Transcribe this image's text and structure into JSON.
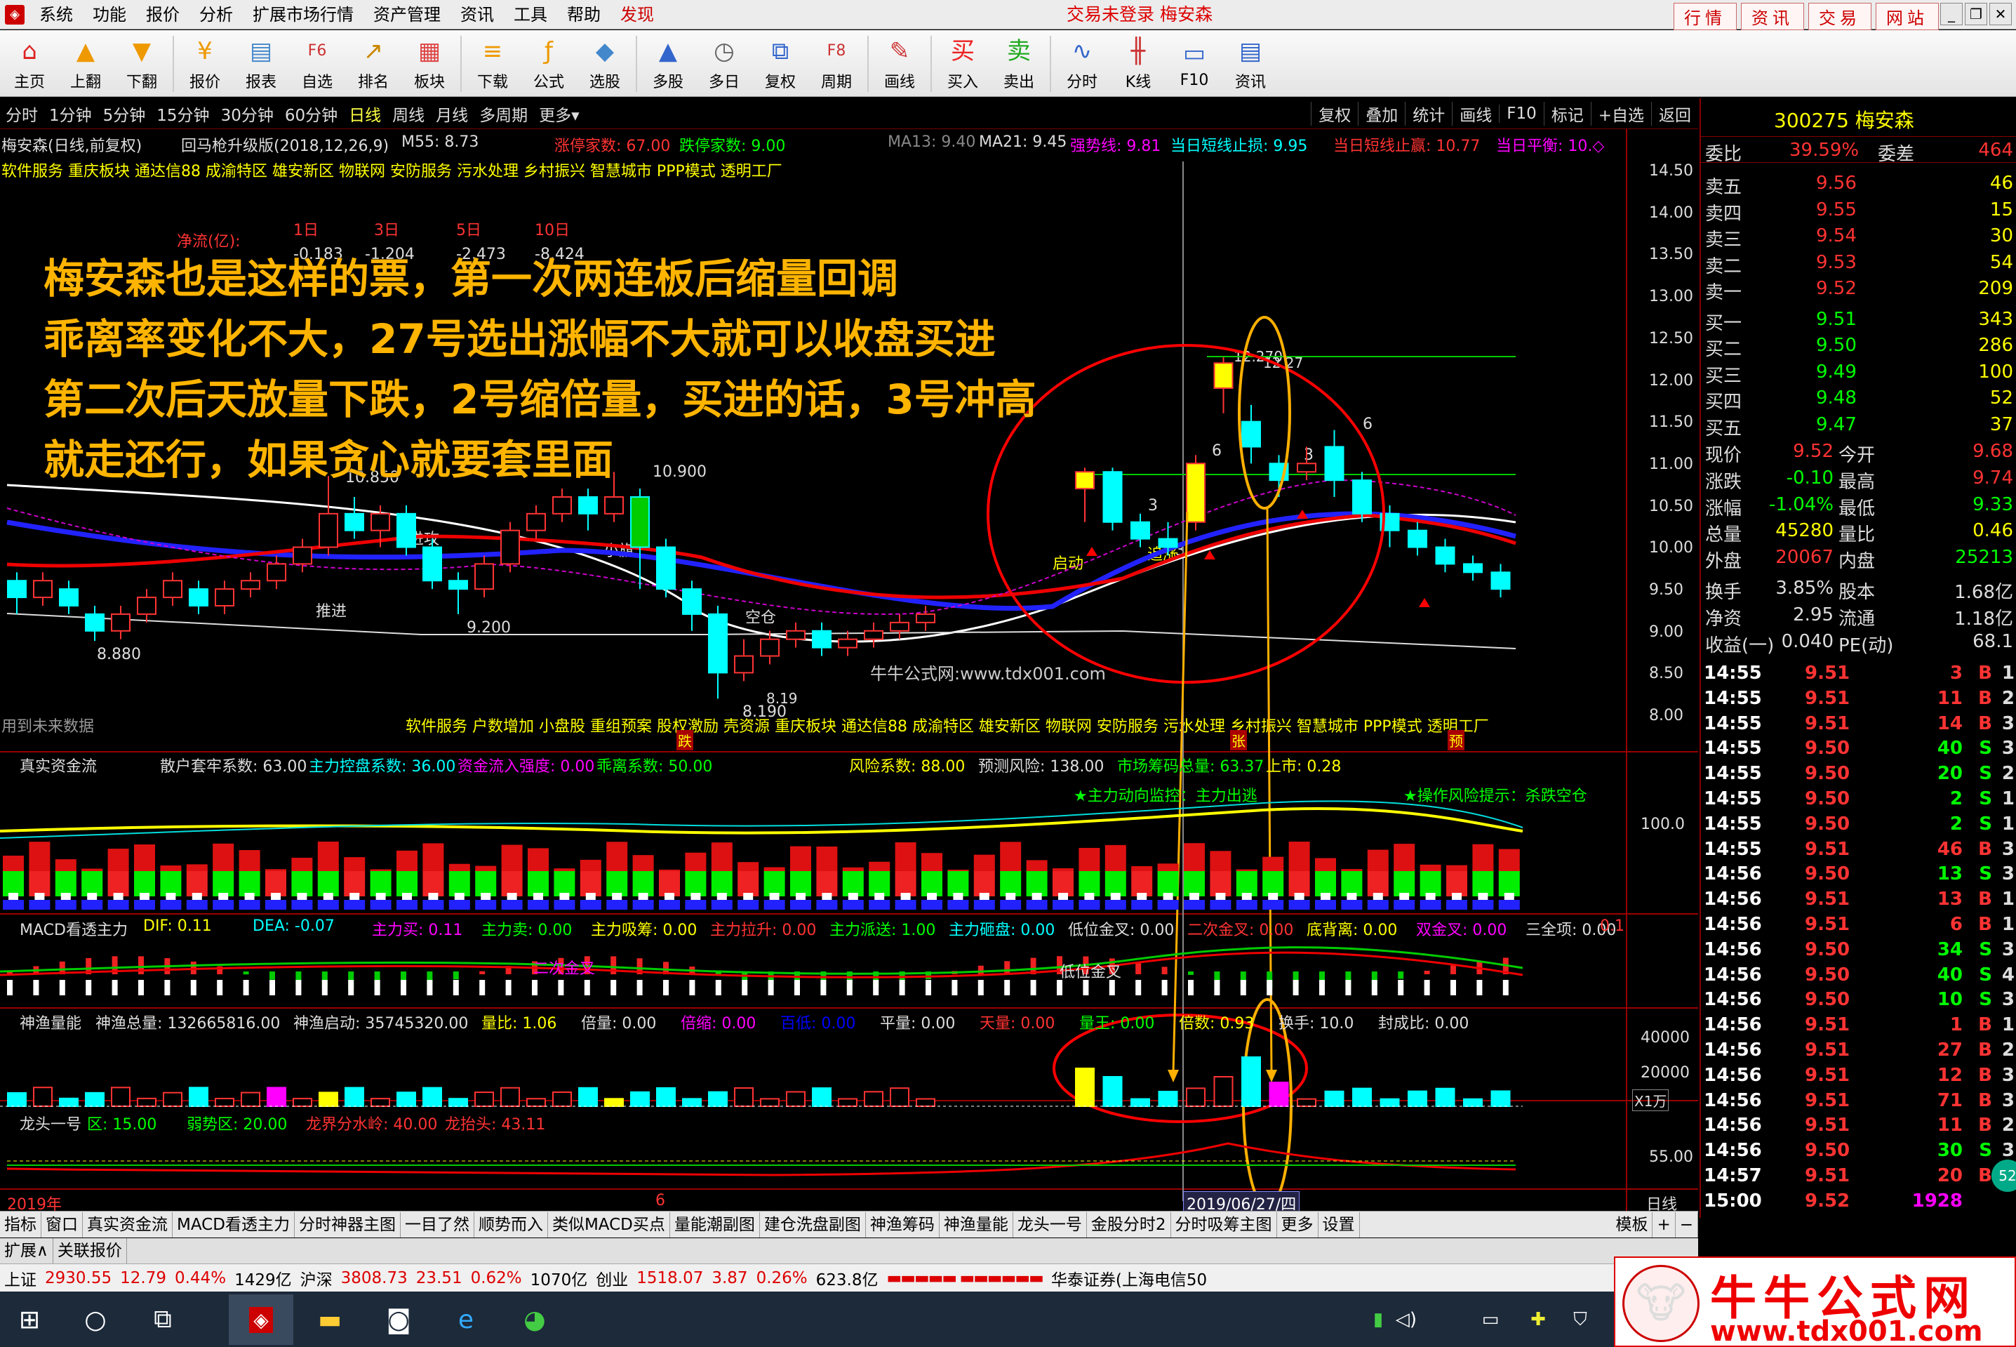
{
  "menubar": {
    "items": [
      "系统",
      "功能",
      "报价",
      "分析",
      "扩展市场行情",
      "资产管理",
      "资讯",
      "工具",
      "帮助"
    ],
    "active": "发现",
    "center": "交易未登录  梅安森",
    "right_tabs": [
      "行情",
      "资讯",
      "交易",
      "网站"
    ]
  },
  "toolbar": [
    {
      "label": "主页",
      "icon": "home-icon",
      "glyph": "⌂",
      "color": "#d22"
    },
    {
      "label": "上翻",
      "icon": "arrow-up-icon",
      "glyph": "▲",
      "color": "#e90"
    },
    {
      "label": "下翻",
      "icon": "arrow-down-icon",
      "glyph": "▼",
      "color": "#e90"
    },
    {
      "label": "报价",
      "icon": "yen-icon",
      "glyph": "¥",
      "color": "#e90"
    },
    {
      "label": "报表",
      "icon": "report-icon",
      "glyph": "▤",
      "color": "#48c"
    },
    {
      "label": "自选",
      "icon": "f6-icon",
      "glyph": "F6",
      "color": "#c33"
    },
    {
      "label": "排名",
      "icon": "rank-icon",
      "glyph": "↗",
      "color": "#c80"
    },
    {
      "label": "板块",
      "icon": "block-icon",
      "glyph": "▦",
      "color": "#d44"
    },
    {
      "label": "下载",
      "icon": "download-icon",
      "glyph": "≡",
      "color": "#e90"
    },
    {
      "label": "公式",
      "icon": "formula-icon",
      "glyph": "ƒ",
      "color": "#e90"
    },
    {
      "label": "选股",
      "icon": "stock-pick-icon",
      "glyph": "◆",
      "color": "#48c"
    },
    {
      "label": "多股",
      "icon": "multi-stock-icon",
      "glyph": "▲",
      "color": "#36c"
    },
    {
      "label": "多日",
      "icon": "clock-icon",
      "glyph": "◷",
      "color": "#666"
    },
    {
      "label": "复权",
      "icon": "restore-icon",
      "glyph": "⧉",
      "color": "#36c"
    },
    {
      "label": "周期",
      "icon": "f8-icon",
      "glyph": "F8",
      "color": "#c33"
    },
    {
      "label": "画线",
      "icon": "pencil-icon",
      "glyph": "✎",
      "color": "#c33"
    },
    {
      "label": "买入",
      "icon": "buy-icon",
      "glyph": "买",
      "color": "#e22"
    },
    {
      "label": "卖出",
      "icon": "sell-icon",
      "glyph": "卖",
      "color": "#2a2"
    },
    {
      "label": "分时",
      "icon": "timeline-icon",
      "glyph": "∿",
      "color": "#36c"
    },
    {
      "label": "K线",
      "icon": "kline-icon",
      "glyph": "╫",
      "color": "#c33"
    },
    {
      "label": "F10",
      "icon": "f10-icon",
      "glyph": "▭",
      "color": "#36c"
    },
    {
      "label": "资讯",
      "icon": "news-icon",
      "glyph": "▤",
      "color": "#36c"
    }
  ],
  "periods": [
    "分时",
    "1分钟",
    "5分钟",
    "15分钟",
    "30分钟",
    "60分钟",
    "日线",
    "周线",
    "月线",
    "多周期",
    "更多▾"
  ],
  "period_active": "日线",
  "period_right": [
    "复权",
    "叠加",
    "统计",
    "画线",
    "F10",
    "标记",
    "+自选",
    "返回"
  ],
  "main": {
    "title": "梅安森(日线,前复权)",
    "formula": "回马枪升级版(2018,12,26,9)",
    "m55": "M55: 8.73",
    "zt": "涨停家数: 67.00",
    "dt": "跌停家数: 9.00",
    "ma13": "MA13: 9.40",
    "ma21": "MA21: 9.45",
    "qsx": "强势线: 9.81",
    "stop_loss": "当日短线止损: 9.95",
    "stop_profit": "当日短线止赢: 10.77",
    "balance": "当日平衡: 10.◇",
    "concepts": "软件服务 重庆板块 通达信88 成渝特区 雄安新区 物联网 安防服务 污水处理 乡村振兴 智慧城市 PPP模式 透明工厂",
    "concepts_bottom": "软件服务 户数增加 小盘股 重组预案 股权激励 壳资源 重庆板块 通达信88 成渝特区 雄安新区 物联网 安防服务 污水处理 乡村振兴 智慧城市 PPP模式 透明工厂",
    "flow_title": "净流(亿):",
    "flow_heads": [
      "1日",
      "3日",
      "5日",
      "10日"
    ],
    "flow_vals": [
      "-0.183",
      "-1.204",
      "-2.473",
      "-8.424"
    ],
    "future_data": "用到未来数据",
    "watermark": "牛牛公式网:www.tdx001.com",
    "labels": {
      "tuijin": "推进",
      "jinggong": "进攻",
      "xiaoqi": "小旗",
      "kongcang": "空仓",
      "qidong": "启动",
      "zhuangqi": "追涨"
    },
    "prices": {
      "p1": "10.850",
      "p2": "10.900",
      "p3": "9.200",
      "p4": "8.880",
      "p5": "8.190",
      "p6": "8.19",
      "p7": "12.270",
      "p8": "12.27"
    },
    "markers": {
      "die": "跌",
      "zhang": "张",
      "yu": "预"
    },
    "y_ticks": [
      "14.50",
      "14.00",
      "13.50",
      "13.00",
      "12.50",
      "12.00",
      "11.50",
      "11.00",
      "10.50",
      "10.00",
      "9.50",
      "9.00",
      "8.50",
      "8.00"
    ],
    "counts": [
      "3",
      "3",
      "6",
      "3",
      "6"
    ]
  },
  "annotation": [
    "梅安森也是这样的票，第一次两连板后缩量回调",
    "乖离率变化不大，27号选出涨幅不大就可以收盘买进",
    "第二次后天放量下跌，2号缩倍量，买进的话，3号冲高",
    "就走还行，如果贪心就要套里面"
  ],
  "panel1": {
    "title": "真实资金流",
    "items": [
      "散户套牢系数: 63.00",
      "主力控盘系数: 36.00",
      "资金流入强度: 0.00",
      "乖离系数: 50.00",
      "风险系数: 88.00",
      "预测风险: 138.00",
      "市场筹码总量: 63.37",
      "上市: 0.28"
    ],
    "alert1": "★主力动向监控：主力出逃",
    "alert2": "★操作风险提示：杀跌空仓",
    "tick": "100.0"
  },
  "panel2": {
    "title": "MACD看透主力",
    "items": [
      "DIF: 0.11",
      "DEA: -0.07",
      "主力买: 0.11",
      "主力卖: 0.00",
      "主力吸筹: 0.00",
      "主力拉升: 0.00",
      "主力派送: 1.00",
      "主力砸盘: 0.00",
      "低位金叉: 0.00",
      "二次金叉: 0.00",
      "底背离: 0.00",
      "双金叉: 0.00",
      "三全项: 0.00"
    ],
    "right": "0.1",
    "cross1": "二次金叉",
    "cross2": "低位金叉"
  },
  "panel3": {
    "title": "神渔量能",
    "items": [
      "神渔总量: 132665816.00",
      "神渔启动: 35745320.00",
      "量比: 1.06",
      "倍量: 0.00",
      "倍缩: 0.00",
      "百低: 0.00",
      "平量: 0.00",
      "天量: 0.00",
      "量王: 0.00",
      "倍数: 0.93",
      "换手: 10.0",
      "封成比: 0.00"
    ],
    "ticks": [
      "40000",
      "20000",
      "X1万"
    ]
  },
  "panel4": {
    "title": "龙头一号",
    "items": [
      "区: 15.00",
      "弱势区: 20.00",
      "龙界分水岭: 40.00",
      "龙抬头: 43.11"
    ],
    "tick": "55.00"
  },
  "xaxis": {
    "left": "2019年",
    "mid": "6",
    "cursor": "2019/06/27/四",
    "right": "日线"
  },
  "rightpanel": {
    "code": "300275 梅安森",
    "weibi_label": "委比",
    "weibi": "39.59%",
    "weicha_label": "委差",
    "weicha": "464",
    "sells": [
      {
        "label": "卖五",
        "price": "9.56",
        "vol": "46"
      },
      {
        "label": "卖四",
        "price": "9.55",
        "vol": "15"
      },
      {
        "label": "卖三",
        "price": "9.54",
        "vol": "30"
      },
      {
        "label": "卖二",
        "price": "9.53",
        "vol": "54"
      },
      {
        "label": "卖一",
        "price": "9.52",
        "vol": "209"
      }
    ],
    "buys": [
      {
        "label": "买一",
        "price": "9.51",
        "vol": "343"
      },
      {
        "label": "买二",
        "price": "9.50",
        "vol": "286"
      },
      {
        "label": "买三",
        "price": "9.49",
        "vol": "100"
      },
      {
        "label": "买四",
        "price": "9.48",
        "vol": "52"
      },
      {
        "label": "买五",
        "price": "9.47",
        "vol": "37"
      }
    ],
    "stats": [
      {
        "l1": "现价",
        "v1": "9.52",
        "l2": "今开",
        "v2": "9.68",
        "c1": "#f33",
        "c2": "#f33"
      },
      {
        "l1": "涨跌",
        "v1": "-0.10",
        "l2": "最高",
        "v2": "9.74",
        "c1": "#0f0",
        "c2": "#f33"
      },
      {
        "l1": "涨幅",
        "v1": "-1.04%",
        "l2": "最低",
        "v2": "9.33",
        "c1": "#0f0",
        "c2": "#0f0"
      },
      {
        "l1": "总量",
        "v1": "45280",
        "l2": "量比",
        "v2": "0.46",
        "c1": "#ff0",
        "c2": "#ff0"
      },
      {
        "l1": "外盘",
        "v1": "20067",
        "l2": "内盘",
        "v2": "25213",
        "c1": "#f33",
        "c2": "#0f0"
      },
      {
        "l1": "换手",
        "v1": "3.85%",
        "l2": "股本",
        "v2": "1.68亿",
        "c1": "#ddd",
        "c2": "#ddd"
      },
      {
        "l1": "净资",
        "v1": "2.95",
        "l2": "流通",
        "v2": "1.18亿",
        "c1": "#ddd",
        "c2": "#ddd"
      },
      {
        "l1": "收益(一)",
        "v1": "0.040",
        "l2": "PE(动)",
        "v2": "68.1",
        "c1": "#ddd",
        "c2": "#ddd"
      }
    ],
    "ticks": [
      {
        "t": "14:55",
        "p": "9.51",
        "v": "3",
        "s": "B",
        "n": "1"
      },
      {
        "t": "14:55",
        "p": "9.51",
        "v": "11",
        "s": "B",
        "n": "2"
      },
      {
        "t": "14:55",
        "p": "9.51",
        "v": "14",
        "s": "B",
        "n": "3"
      },
      {
        "t": "14:55",
        "p": "9.50",
        "v": "40",
        "s": "S",
        "n": "3"
      },
      {
        "t": "14:55",
        "p": "9.50",
        "v": "20",
        "s": "S",
        "n": "2"
      },
      {
        "t": "14:55",
        "p": "9.50",
        "v": "2",
        "s": "S",
        "n": "1"
      },
      {
        "t": "14:55",
        "p": "9.50",
        "v": "2",
        "s": "S",
        "n": "1"
      },
      {
        "t": "14:55",
        "p": "9.51",
        "v": "46",
        "s": "B",
        "n": "3"
      },
      {
        "t": "14:56",
        "p": "9.50",
        "v": "13",
        "s": "S",
        "n": "3"
      },
      {
        "t": "14:56",
        "p": "9.51",
        "v": "13",
        "s": "B",
        "n": "1"
      },
      {
        "t": "14:56",
        "p": "9.51",
        "v": "6",
        "s": "B",
        "n": "1"
      },
      {
        "t": "14:56",
        "p": "9.50",
        "v": "34",
        "s": "S",
        "n": "3"
      },
      {
        "t": "14:56",
        "p": "9.50",
        "v": "40",
        "s": "S",
        "n": "4"
      },
      {
        "t": "14:56",
        "p": "9.50",
        "v": "10",
        "s": "S",
        "n": "3"
      },
      {
        "t": "14:56",
        "p": "9.51",
        "v": "1",
        "s": "B",
        "n": "1"
      },
      {
        "t": "14:56",
        "p": "9.51",
        "v": "27",
        "s": "B",
        "n": "2"
      },
      {
        "t": "14:56",
        "p": "9.51",
        "v": "12",
        "s": "B",
        "n": "3"
      },
      {
        "t": "14:56",
        "p": "9.51",
        "v": "71",
        "s": "B",
        "n": "3"
      },
      {
        "t": "14:56",
        "p": "9.51",
        "v": "11",
        "s": "B",
        "n": "2"
      },
      {
        "t": "14:56",
        "p": "9.50",
        "v": "30",
        "s": "S",
        "n": "3"
      },
      {
        "t": "14:57",
        "p": "9.51",
        "v": "20",
        "s": "B",
        "n": "3"
      },
      {
        "t": "15:00",
        "p": "9.52",
        "v": "1928",
        "s": "",
        "n": ""
      }
    ],
    "bottom_badge": "52"
  },
  "tabs": [
    "指标",
    "窗口",
    "真实资金流",
    "MACD看透主力",
    "分时神器主图",
    "一目了然",
    "顺势而入",
    "类似MACD买点",
    "量能潮副图",
    "建仓洗盘副图",
    "神渔筹码",
    "神渔量能",
    "龙头一号",
    "金股分时2",
    "分时吸筹主图",
    "更多",
    "设置"
  ],
  "tabs_right": [
    "模板",
    "+",
    "−"
  ],
  "tabs2": [
    "扩展∧",
    "关联报价"
  ],
  "status": {
    "sh_label": "上证",
    "sh": "2930.55",
    "sh_chg": "12.79",
    "sh_pct": "0.44%",
    "sh_amt": "1429亿",
    "hs_label": "沪深",
    "hs": "3808.73",
    "hs_chg": "23.51",
    "hs_pct": "0.62%",
    "hs_amt": "1070亿",
    "cy_label": "创业",
    "cy": "1518.07",
    "cy_chg": "3.87",
    "cy_pct": "0.26%",
    "cy_amt": "623.8亿",
    "broker": "华泰证券(上海电信50"
  },
  "logo": {
    "title": "牛牛公式网",
    "url": "www.tdx001.com"
  },
  "chart_data": {
    "type": "candlestick",
    "title": "梅安森(日线,前复权)",
    "y_ticks": [
      14.5,
      14.0,
      13.5,
      13.0,
      12.5,
      12.0,
      11.5,
      11.0,
      10.5,
      10.0,
      9.5,
      9.0,
      8.5,
      8.0
    ],
    "ylim": [
      7.8,
      14.7
    ],
    "candles": [
      [
        9.4,
        9.6,
        9.2,
        9.7,
        "d"
      ],
      [
        9.6,
        9.4,
        9.3,
        9.7,
        "u"
      ],
      [
        9.5,
        9.3,
        9.2,
        9.6,
        "d"
      ],
      [
        9.2,
        9.0,
        8.88,
        9.3,
        "d"
      ],
      [
        9.0,
        9.2,
        8.9,
        9.3,
        "u"
      ],
      [
        9.2,
        9.4,
        9.1,
        9.5,
        "u"
      ],
      [
        9.4,
        9.6,
        9.3,
        9.7,
        "u"
      ],
      [
        9.5,
        9.3,
        9.2,
        9.6,
        "d"
      ],
      [
        9.3,
        9.5,
        9.2,
        9.6,
        "u"
      ],
      [
        9.5,
        9.6,
        9.4,
        9.7,
        "u"
      ],
      [
        9.6,
        9.8,
        9.5,
        9.9,
        "u"
      ],
      [
        9.8,
        10.0,
        9.7,
        10.1,
        "u"
      ],
      [
        10.0,
        10.4,
        9.9,
        10.85,
        "u"
      ],
      [
        10.4,
        10.2,
        10.1,
        10.6,
        "d"
      ],
      [
        10.2,
        10.4,
        10.0,
        10.5,
        "u"
      ],
      [
        10.4,
        10.0,
        9.9,
        10.5,
        "d"
      ],
      [
        10.0,
        9.6,
        9.5,
        10.1,
        "d"
      ],
      [
        9.6,
        9.5,
        9.2,
        9.7,
        "d"
      ],
      [
        9.5,
        9.8,
        9.4,
        9.9,
        "u"
      ],
      [
        9.8,
        10.2,
        9.7,
        10.3,
        "u"
      ],
      [
        10.2,
        10.4,
        10.1,
        10.5,
        "u"
      ],
      [
        10.4,
        10.6,
        10.3,
        10.7,
        "u"
      ],
      [
        10.6,
        10.4,
        10.2,
        10.7,
        "d"
      ],
      [
        10.4,
        10.6,
        10.3,
        10.9,
        "u"
      ],
      [
        10.6,
        10.0,
        9.5,
        10.7,
        "d"
      ],
      [
        10.0,
        9.5,
        9.4,
        10.1,
        "d"
      ],
      [
        9.5,
        9.2,
        9.0,
        9.6,
        "d"
      ],
      [
        9.2,
        8.5,
        8.19,
        9.3,
        "d"
      ],
      [
        8.5,
        8.7,
        8.4,
        8.9,
        "u"
      ],
      [
        8.7,
        8.9,
        8.6,
        9.0,
        "u"
      ],
      [
        8.9,
        9.0,
        8.8,
        9.1,
        "u"
      ],
      [
        9.0,
        8.8,
        8.7,
        9.1,
        "d"
      ],
      [
        8.8,
        8.9,
        8.7,
        9.0,
        "u"
      ],
      [
        8.9,
        9.0,
        8.8,
        9.1,
        "u"
      ],
      [
        9.0,
        9.1,
        8.9,
        9.2,
        "u"
      ],
      [
        9.1,
        9.2,
        9.0,
        9.3,
        "u"
      ],
      [
        10.7,
        10.9,
        10.3,
        10.95,
        "u"
      ],
      [
        10.9,
        10.3,
        10.2,
        10.95,
        "d"
      ],
      [
        10.3,
        10.1,
        10.0,
        10.4,
        "d"
      ],
      [
        10.1,
        10.0,
        9.9,
        10.3,
        "d"
      ],
      [
        10.3,
        11.0,
        10.2,
        11.1,
        "u"
      ],
      [
        11.9,
        12.2,
        11.6,
        12.27,
        "u"
      ],
      [
        11.5,
        11.2,
        11.0,
        11.7,
        "d"
      ],
      [
        11.0,
        10.8,
        10.6,
        11.1,
        "d"
      ],
      [
        10.9,
        11.0,
        10.8,
        11.2,
        "u"
      ],
      [
        11.2,
        10.8,
        10.6,
        11.4,
        "d"
      ],
      [
        10.8,
        10.4,
        10.3,
        10.9,
        "d"
      ],
      [
        10.4,
        10.2,
        10.0,
        10.5,
        "d"
      ],
      [
        10.2,
        10.0,
        9.9,
        10.3,
        "d"
      ],
      [
        10.0,
        9.8,
        9.7,
        10.1,
        "d"
      ],
      [
        9.8,
        9.7,
        9.6,
        9.9,
        "d"
      ],
      [
        9.7,
        9.5,
        9.4,
        9.8,
        "d"
      ]
    ]
  }
}
